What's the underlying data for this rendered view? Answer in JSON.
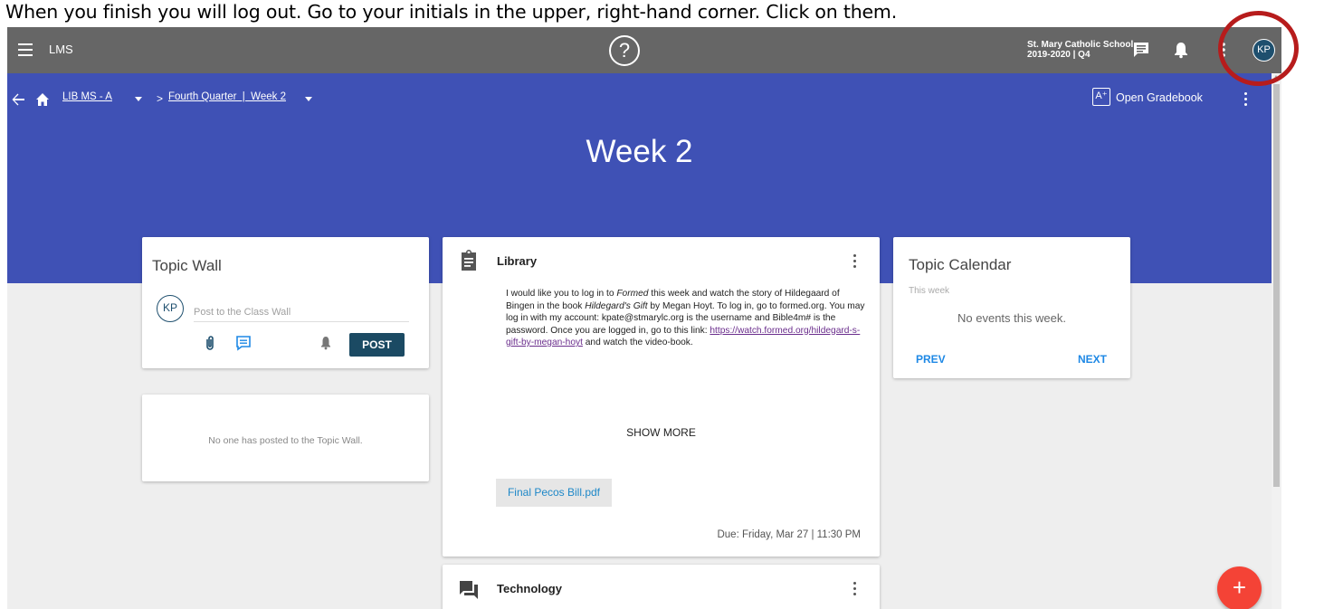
{
  "instruction": "When you finish you will log out.  Go to your initials in the upper, right-hand corner.  Click on them.",
  "topbar": {
    "app_name": "LMS",
    "help_glyph": "?",
    "school_name": "St. Mary Catholic School",
    "school_term": "2019-2020 | Q4",
    "user_initials": "KP"
  },
  "breadcrumb": {
    "course": "LIB MS - A",
    "section": "Fourth Quarter  |  Week 2"
  },
  "banner": {
    "gradebook_label": "Open Gradebook",
    "gradebook_glyph": "A⁺",
    "title": "Week 2",
    "color": "#3f51b5"
  },
  "topic_wall": {
    "title": "Topic Wall",
    "avatar_initials": "KP",
    "placeholder": "Post to the Class Wall",
    "post_label": "POST",
    "empty_message": "No one has posted to the Topic Wall."
  },
  "library": {
    "title": "Library",
    "body_part1": "I would like you to log in to ",
    "body_italic1": "Formed",
    "body_part2": " this week and watch the story of Hildegaard of Bingen in the book ",
    "body_italic2": "Hildegard's Gift",
    "body_part3": " by Megan Hoyt.  To log in, go to formed.org.  You may log in with my account:  kpate@stmarylc.org is the username and Bible4m# is the password.  Once you are logged in, go to this link:  ",
    "link_text": "https://watch.formed.org/hildegard-s-gift-by-megan-hoyt",
    "body_part4": " and watch the video-book.",
    "show_more": "SHOW MORE",
    "attachment": "Final Pecos Bill.pdf",
    "due": "Due: Friday, Mar 27 | 11:30 PM"
  },
  "technology": {
    "title": "Technology"
  },
  "topic_calendar": {
    "title": "Topic Calendar",
    "week_label": "This week",
    "empty_message": "No events this week.",
    "prev_label": "PREV",
    "next_label": "NEXT"
  },
  "fab": {
    "glyph": "+",
    "color": "#f44336"
  },
  "highlight_color": "#b71c1c"
}
